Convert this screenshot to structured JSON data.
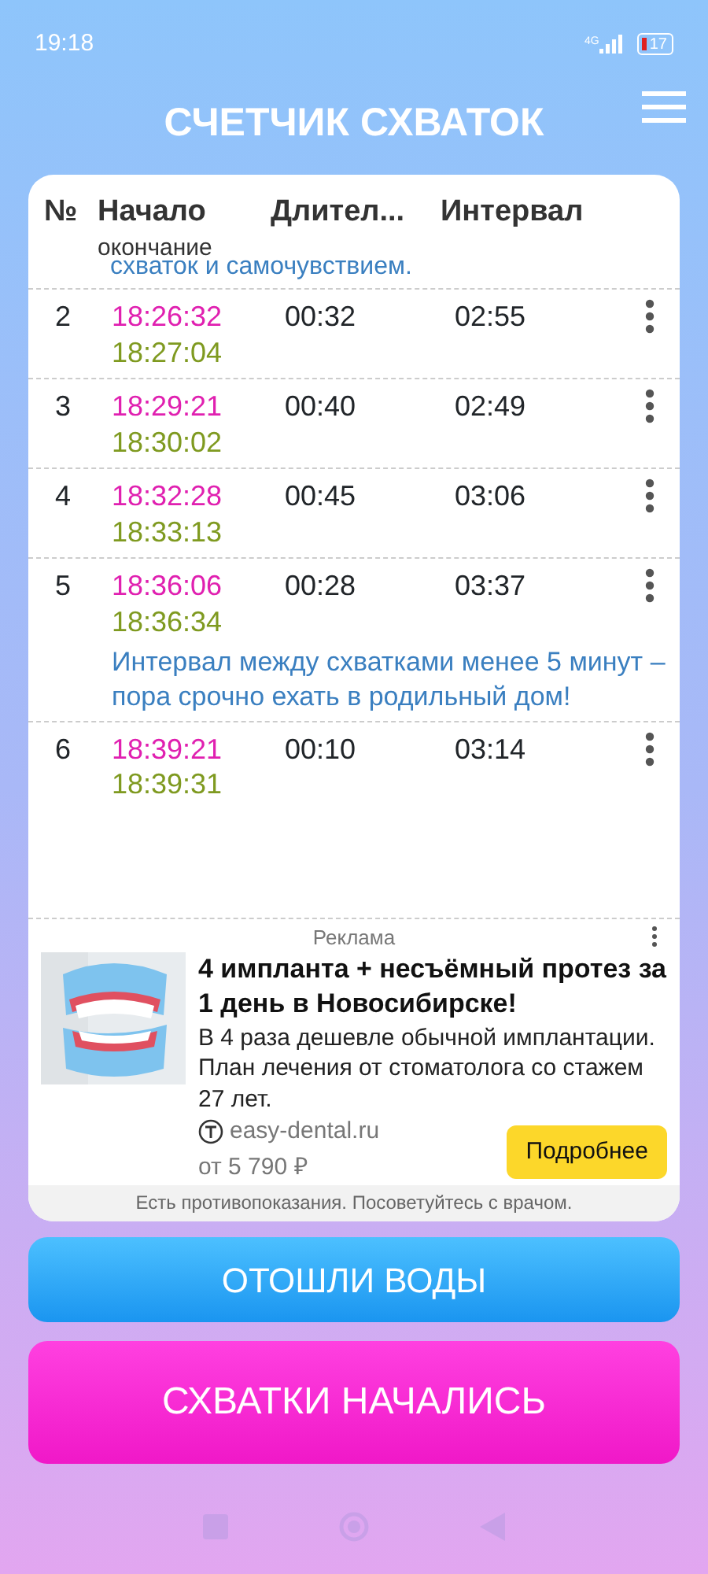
{
  "status_bar": {
    "time": "19:18",
    "network": "4G",
    "battery": "17"
  },
  "title": "СЧЕТЧИК СХВАТОК",
  "table": {
    "columns": {
      "number": "№",
      "start": "Начало",
      "end": "окончание",
      "duration": "Длител...",
      "interval": "Интервал"
    },
    "top_note": "схваток и самочувствием.",
    "rows": [
      {
        "number": "2",
        "start": "18:26:32",
        "end": "18:27:04",
        "duration": "00:32",
        "interval": "02:55"
      },
      {
        "number": "3",
        "start": "18:29:21",
        "end": "18:30:02",
        "duration": "00:40",
        "interval": "02:49"
      },
      {
        "number": "4",
        "start": "18:32:28",
        "end": "18:33:13",
        "duration": "00:45",
        "interval": "03:06"
      },
      {
        "number": "5",
        "start": "18:36:06",
        "end": "18:36:34",
        "duration": "00:28",
        "interval": "03:37",
        "note": "Интервал между схватками менее 5 минут – пора срочно ехать в родильный дом!"
      },
      {
        "number": "6",
        "start": "18:39:21",
        "end": "18:39:31",
        "duration": "00:10",
        "interval": "03:14"
      }
    ]
  },
  "ad": {
    "label": "Реклама",
    "title": "4 импланта + несъёмный протез за 1 день в Новосибирске!",
    "text": "В 4 раза дешевле обычной имплантации. План лечения от стоматолога со стажем 27 лет.",
    "domain": "easy-dental.ru",
    "price": "от 5 790 ₽",
    "button": "Подробнее",
    "disclaimer": "Есть противопоказания. Посоветуйтесь с врачом."
  },
  "buttons": [
    {
      "kind": "water",
      "label": "ОТОШЛИ ВОДЫ"
    },
    {
      "kind": "start",
      "label": "СХВАТКИ НАЧАЛИСЬ"
    }
  ]
}
